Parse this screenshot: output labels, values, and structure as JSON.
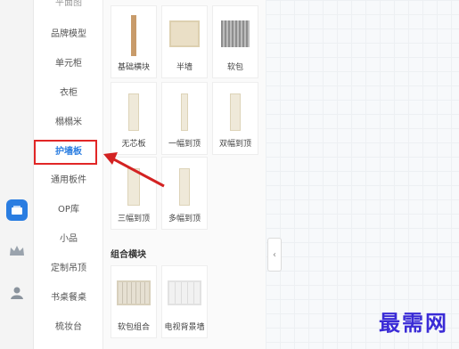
{
  "categories": [
    {
      "label": "平面图"
    },
    {
      "label": "品牌模型"
    },
    {
      "label": "单元柜"
    },
    {
      "label": "衣柜"
    },
    {
      "label": "榻榻米"
    },
    {
      "label": "护墙板"
    },
    {
      "label": "通用板件"
    },
    {
      "label": "OP库"
    },
    {
      "label": "小品"
    },
    {
      "label": "定制吊顶"
    },
    {
      "label": "书桌餐桌"
    },
    {
      "label": "梳妆台"
    }
  ],
  "tiles": [
    {
      "label": "基础横块"
    },
    {
      "label": "半墙"
    },
    {
      "label": "软包"
    },
    {
      "label": "无芯板"
    },
    {
      "label": "一幅到顶"
    },
    {
      "label": "双幅到顶"
    },
    {
      "label": "三幅到顶"
    },
    {
      "label": "多幅到顶"
    }
  ],
  "section": {
    "title": "组合横块"
  },
  "combo_tiles": [
    {
      "label": "软包组合"
    },
    {
      "label": "电视背景墙"
    }
  ],
  "collapse": {
    "glyph": "‹"
  },
  "watermark": "最需网",
  "colors": {
    "accent": "#2a7de1",
    "highlight": "#e12626",
    "arrow": "#d32222"
  }
}
